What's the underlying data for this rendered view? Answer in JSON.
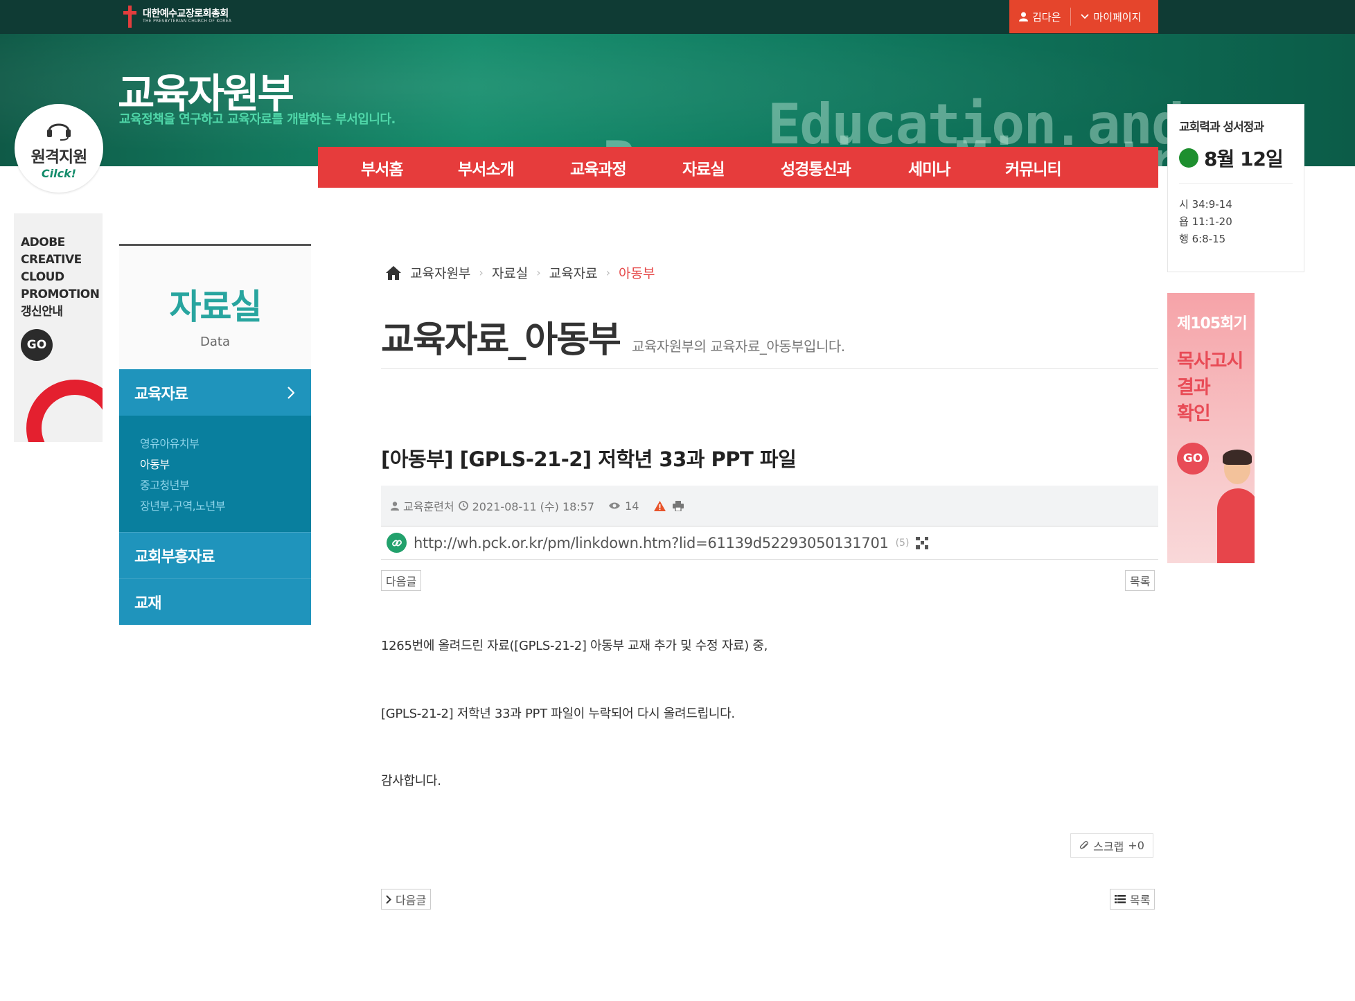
{
  "header": {
    "logo_main": "대한예수교장로회총회",
    "logo_sub": "THE PRESBYTERIAN CHURCH OF KOREA",
    "user_name": "김다은",
    "mypage": "마이페이지",
    "dept_title": "교육자원부",
    "dept_sub": "교육정책을 연구하고 교육자료를 개발하는 부서입니다.",
    "bg_text_1": "Education and",
    "bg_text_2": "Resourcing Ministry",
    "remote_main": "원격지원",
    "remote_sub": "Cilck!"
  },
  "gnb": [
    "부서홈",
    "부서소개",
    "교육과정",
    "자료실",
    "성경통신과",
    "세미나",
    "커뮤니티"
  ],
  "calendar": {
    "title": "교회력과 성서정과",
    "date": "8월 12일",
    "verses": [
      "시 34:9-14",
      "욥 11:1-20",
      "행 6:8-15"
    ]
  },
  "adobe_banner": {
    "lines": [
      "ADOBE",
      "CREATIVE",
      "CLOUD",
      "PROMOTION",
      "갱신안내"
    ],
    "go": "GO"
  },
  "ad_banner": {
    "top": "제105회기",
    "main": [
      "목사고시",
      "결과",
      "확인"
    ],
    "go": "GO"
  },
  "lnb": {
    "title": "자료실",
    "title_en": "Data",
    "active": "교육자료",
    "sub_items": [
      {
        "label": "영유아유치부",
        "on": false
      },
      {
        "label": "아동부",
        "on": true
      },
      {
        "label": "중고청년부",
        "on": false
      },
      {
        "label": "장년부,구역,노년부",
        "on": false
      }
    ],
    "items": [
      "교회부흥자료",
      "교재"
    ]
  },
  "breadcrumb": [
    "교육자원부",
    "자료실",
    "교육자료",
    "아동부"
  ],
  "page": {
    "title": "교육자료_아동부",
    "desc": "교육자원부의 교육자료_아동부입니다."
  },
  "post": {
    "title": "[아동부] [GPLS-21-2] 저학년 33과 PPT 파일",
    "author": "교육훈련처",
    "datetime": "2021-08-11 (수) 18:57",
    "views": "14",
    "link_url": "http://wh.pck.or.kr/pm/linkdown.htm?lid=61139d52293050131701",
    "link_count": "(5)",
    "next_label": "다음글",
    "list_label": "목록",
    "body": [
      "1265번에 올려드린 자료([GPLS-21-2] 아동부 교재 추가 및 수정 자료) 중,",
      "[GPLS-21-2] 저학년 33과 PPT 파일이 누락되어 다시 올려드립니다.",
      "감사합니다."
    ],
    "scrap_label": "스크랩",
    "scrap_count": "+0"
  }
}
